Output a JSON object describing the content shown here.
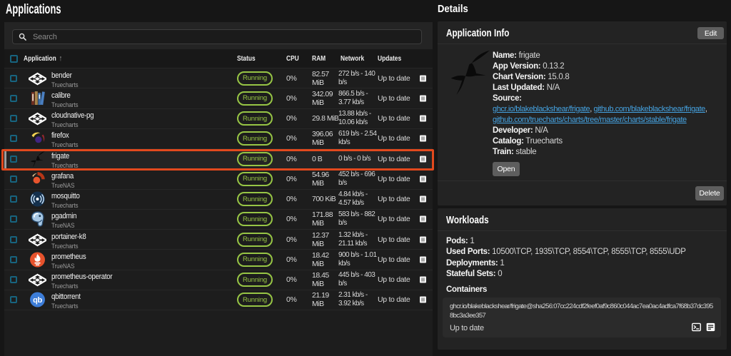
{
  "left": {
    "title": "Applications",
    "search_placeholder": "Search",
    "table": {
      "headers": {
        "application": "Application",
        "status": "Status",
        "cpu": "CPU",
        "ram": "RAM",
        "network": "Network",
        "updates": "Updates"
      },
      "rows": [
        {
          "name": "bender",
          "catalog": "Truecharts",
          "icon": "truecharts",
          "status": "Running",
          "cpu": "0%",
          "ram": "82.57 MiB",
          "network": "272 b/s - 140 b/s",
          "updates": "Up to date",
          "selected": false
        },
        {
          "name": "calibre",
          "catalog": "Truecharts",
          "icon": "calibre",
          "status": "Running",
          "cpu": "0%",
          "ram": "342.09 MiB",
          "network": "866.5 b/s - 3.77 kb/s",
          "updates": "Up to date",
          "selected": false
        },
        {
          "name": "cloudnative-pg",
          "catalog": "Truecharts",
          "icon": "truecharts",
          "status": "Running",
          "cpu": "0%",
          "ram": "29.8 MiB",
          "network": "13.88 kb/s - 10.06 kb/s",
          "updates": "Up to date",
          "selected": false
        },
        {
          "name": "firefox",
          "catalog": "Truecharts",
          "icon": "firefox",
          "status": "Running",
          "cpu": "0%",
          "ram": "396.06 MiB",
          "network": "619 b/s - 2.54 kb/s",
          "updates": "Up to date",
          "selected": false
        },
        {
          "name": "frigate",
          "catalog": "Truecharts",
          "icon": "frigate",
          "status": "Running",
          "cpu": "0%",
          "ram": "0 B",
          "network": "0 b/s - 0 b/s",
          "updates": "Up to date",
          "selected": true
        },
        {
          "name": "grafana",
          "catalog": "TrueNAS",
          "icon": "grafana",
          "status": "Running",
          "cpu": "0%",
          "ram": "54.96 MiB",
          "network": "452 b/s - 696 b/s",
          "updates": "Up to date",
          "selected": false
        },
        {
          "name": "mosquitto",
          "catalog": "Truecharts",
          "icon": "mosquitto",
          "status": "Running",
          "cpu": "0%",
          "ram": "700 KiB",
          "network": "4.84 kb/s - 4.57 kb/s",
          "updates": "Up to date",
          "selected": false
        },
        {
          "name": "pgadmin",
          "catalog": "TrueNAS",
          "icon": "pgadmin",
          "status": "Running",
          "cpu": "0%",
          "ram": "171.88 MiB",
          "network": "583 b/s - 882 b/s",
          "updates": "Up to date",
          "selected": false
        },
        {
          "name": "portainer-k8",
          "catalog": "Truecharts",
          "icon": "truecharts",
          "status": "Running",
          "cpu": "0%",
          "ram": "12.37 MiB",
          "network": "1.32 kb/s - 21.11 kb/s",
          "updates": "Up to date",
          "selected": false
        },
        {
          "name": "prometheus",
          "catalog": "TrueNAS",
          "icon": "prometheus",
          "status": "Running",
          "cpu": "0%",
          "ram": "18.42 MiB",
          "network": "900 b/s - 1.01 kb/s",
          "updates": "Up to date",
          "selected": false
        },
        {
          "name": "prometheus-operator",
          "catalog": "Truecharts",
          "icon": "truecharts",
          "status": "Running",
          "cpu": "0%",
          "ram": "18.45 MiB",
          "network": "445 b/s - 403 b/s",
          "updates": "Up to date",
          "selected": false
        },
        {
          "name": "qbittorrent",
          "catalog": "Truecharts",
          "icon": "qbittorrent",
          "status": "Running",
          "cpu": "0%",
          "ram": "21.19 MiB",
          "network": "2.31 kb/s - 3.92 kb/s",
          "updates": "Up to date",
          "selected": false
        }
      ]
    }
  },
  "details": {
    "title": "Details",
    "app_info": {
      "title": "Application Info",
      "edit_label": "Edit",
      "fields": [
        {
          "label": "Name:",
          "value": "frigate"
        },
        {
          "label": "App Version:",
          "value": "0.13.2"
        },
        {
          "label": "Chart Version:",
          "value": "15.0.8"
        },
        {
          "label": "Last Updated:",
          "value": "N/A"
        }
      ],
      "source_label": "Source:",
      "source_links": [
        "ghcr.io/blakeblackshear/frigate",
        "github.com/blakeblackshear/frigate",
        "github.com/truecharts/charts/tree/master/charts/stable/frigate"
      ],
      "fields2": [
        {
          "label": "Developer:",
          "value": "N/A"
        },
        {
          "label": "Catalog:",
          "value": "Truecharts"
        },
        {
          "label": "Train:",
          "value": "stable"
        }
      ],
      "open_label": "Open",
      "delete_label": "Delete"
    },
    "workloads": {
      "title": "Workloads",
      "stats": [
        {
          "label": "Pods:",
          "value": "1"
        },
        {
          "label": "Used Ports:",
          "value": "10500\\TCP, 1935\\TCP, 8554\\TCP, 8555\\TCP, 8555\\UDP"
        },
        {
          "label": "Deployments:",
          "value": "1"
        },
        {
          "label": "Stateful Sets:",
          "value": "0"
        }
      ],
      "containers_label": "Containers",
      "container_image": "ghcr.io/blakeblackshear/frigate@sha256:07cc224cdf2feef0af9c860c044ac7ea0ac4adfca7f68b37dc3958bc3a3ee357",
      "container_status": "Up to date"
    }
  },
  "colors": {
    "status_running": "#97c545",
    "highlight_red": "#e2491d",
    "link_blue": "#45a3e2",
    "checkbox_teal": "#1a7295"
  }
}
